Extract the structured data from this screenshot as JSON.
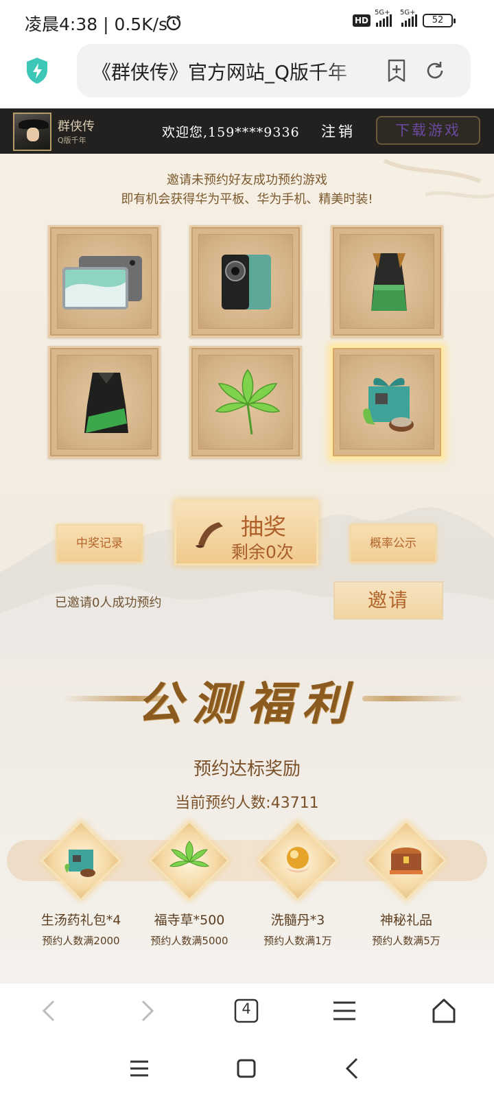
{
  "status_bar": {
    "time": "凌晨4:38 | 0.5K/s",
    "network_badge": "HD",
    "network_1": "5G+",
    "network_2": "5G+",
    "battery": "52"
  },
  "browser": {
    "url_title": "《群侠传》官方网站_Q版千年",
    "tab_count": "4"
  },
  "game_header": {
    "name": "群侠传",
    "subtitle": "Q版千年",
    "welcome": "欢迎您,159****9336",
    "logout_label": "注销",
    "download_label": "下载游戏"
  },
  "invite_section": {
    "line1": "邀请未预约好友成功预约游戏",
    "line2": "即有机会获得华为平板、华为手机、精美时装!",
    "prizes": [
      {
        "icon": "tablet-icon"
      },
      {
        "icon": "phone-icon"
      },
      {
        "icon": "costume-icon"
      },
      {
        "icon": "costume-green-icon"
      },
      {
        "icon": "herb-icon"
      },
      {
        "icon": "gift-box-icon"
      }
    ],
    "record_label": "中奖记录",
    "draw_label": "抽奖",
    "draw_remaining": "剩余0次",
    "probability_label": "概率公示",
    "invited_text": "已邀请0人成功预约",
    "invite_button": "邀请"
  },
  "welfare_section": {
    "heading": "公测福利",
    "subtitle": "预约达标奖励",
    "current_count": "当前预约人数:43711",
    "rewards": [
      {
        "name": "生汤药礼包*4",
        "condition": "预约人数满2000",
        "icon": "gift-box-icon"
      },
      {
        "name": "福寺草*500",
        "condition": "预约人数满5000",
        "icon": "herb-icon"
      },
      {
        "name": "洗髓丹*3",
        "condition": "预约人数满1万",
        "icon": "golden-pill-icon"
      },
      {
        "name": "神秘礼品",
        "condition": "预约人数满5万",
        "icon": "treasure-chest-icon"
      }
    ]
  },
  "colors": {
    "accent_brown": "#7c5a2f",
    "button_gold": "#f1cd93",
    "header_dark": "#23211f"
  }
}
